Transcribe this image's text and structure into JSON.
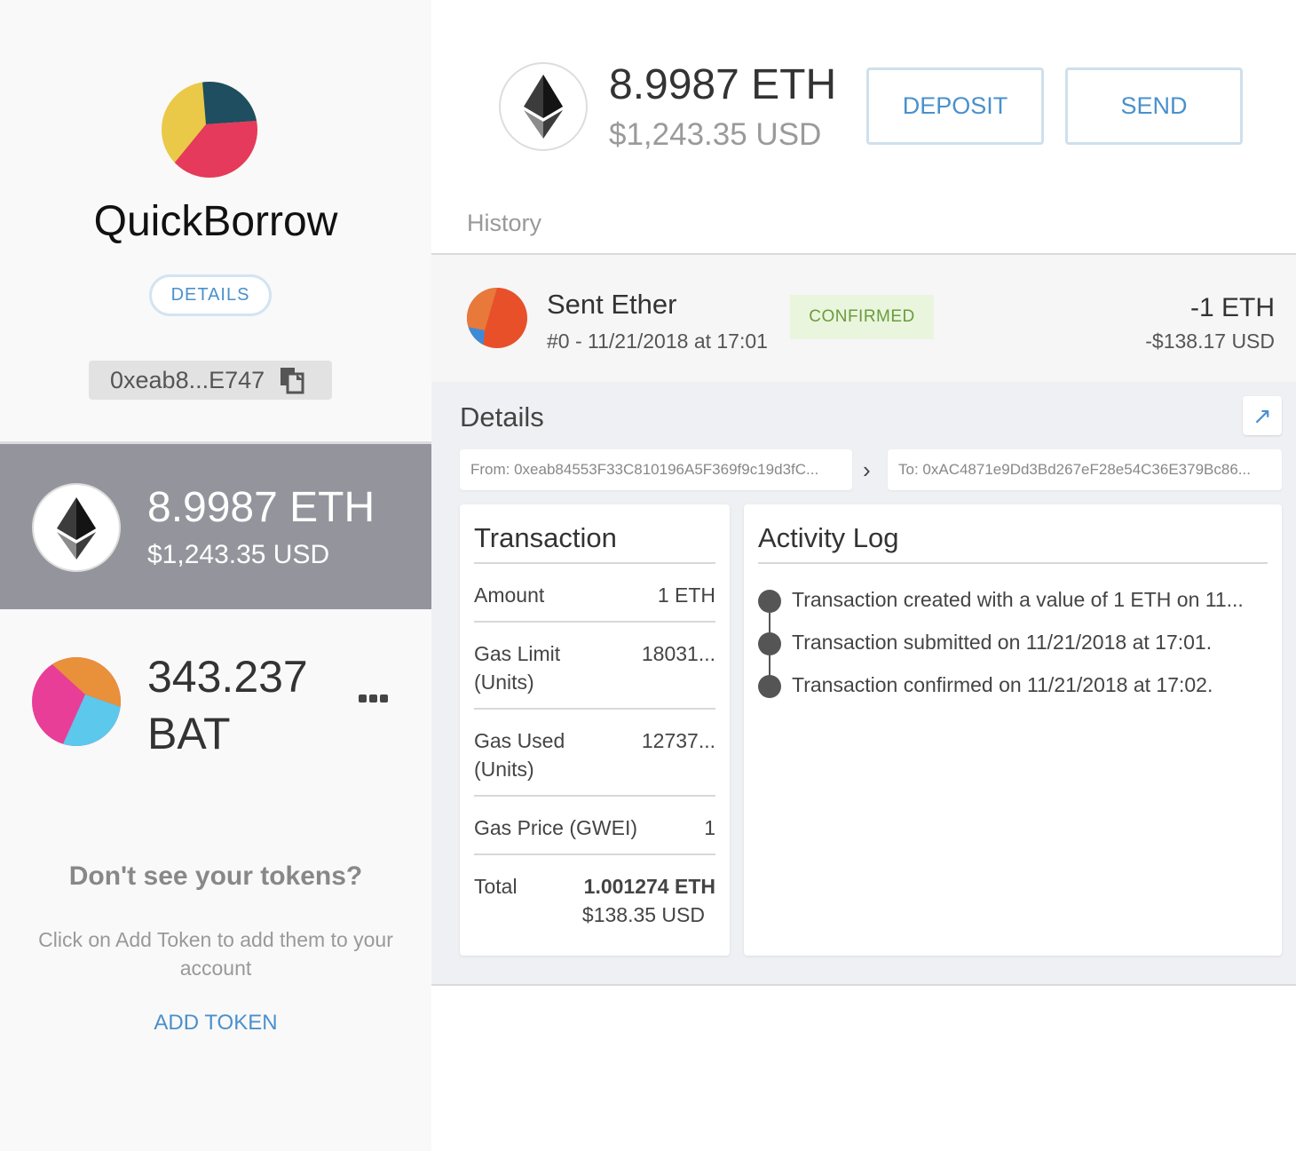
{
  "account": {
    "name": "QuickBorrow",
    "details_label": "DETAILS",
    "address_short": "0xeab8...E747"
  },
  "tokens": [
    {
      "balance": "8.9987 ETH",
      "usd": "$1,243.35 USD",
      "selected": true
    },
    {
      "balance": "343.237 BAT",
      "selected": false
    }
  ],
  "empty_state": {
    "title": "Don't see your tokens?",
    "body": "Click on Add Token to add them to your account",
    "add_label": "ADD TOKEN"
  },
  "header": {
    "balance": "8.9987 ETH",
    "usd": "$1,243.35 USD",
    "deposit_label": "DEPOSIT",
    "send_label": "SEND"
  },
  "history": {
    "label": "History",
    "item": {
      "title": "Sent Ether",
      "subtitle": "#0 - 11/21/2018 at 17:01",
      "status": "CONFIRMED",
      "amount": "-1 ETH",
      "amount_usd": "-$138.17 USD"
    }
  },
  "details": {
    "title": "Details",
    "from": "From: 0xeab84553F33C810196A5F369f9c19d3fC...",
    "to": "To: 0xAC4871e9Dd3Bd267eF28e54C36E379Bc86...",
    "transaction": {
      "title": "Transaction",
      "amount_label": "Amount",
      "amount_value": "1 ETH",
      "gas_limit_label": "Gas Limit (Units)",
      "gas_limit_value": "18031...",
      "gas_used_label": "Gas Used (Units)",
      "gas_used_value": "12737...",
      "gas_price_label": "Gas Price (GWEI)",
      "gas_price_value": "1",
      "total_label": "Total",
      "total_eth": "1.001274 ETH",
      "total_usd": "$138.35 USD"
    },
    "activity": {
      "title": "Activity Log",
      "items": [
        "Transaction created with a value of 1 ETH on 11...",
        "Transaction submitted on 11/21/2018 at 17:01.",
        "Transaction confirmed on 11/21/2018 at 17:02."
      ]
    }
  },
  "colors": {
    "accent": "#4a90cc",
    "selected_row": "#94959c",
    "status_bg": "#eaf5dd",
    "status_text": "#6a9c3c"
  }
}
